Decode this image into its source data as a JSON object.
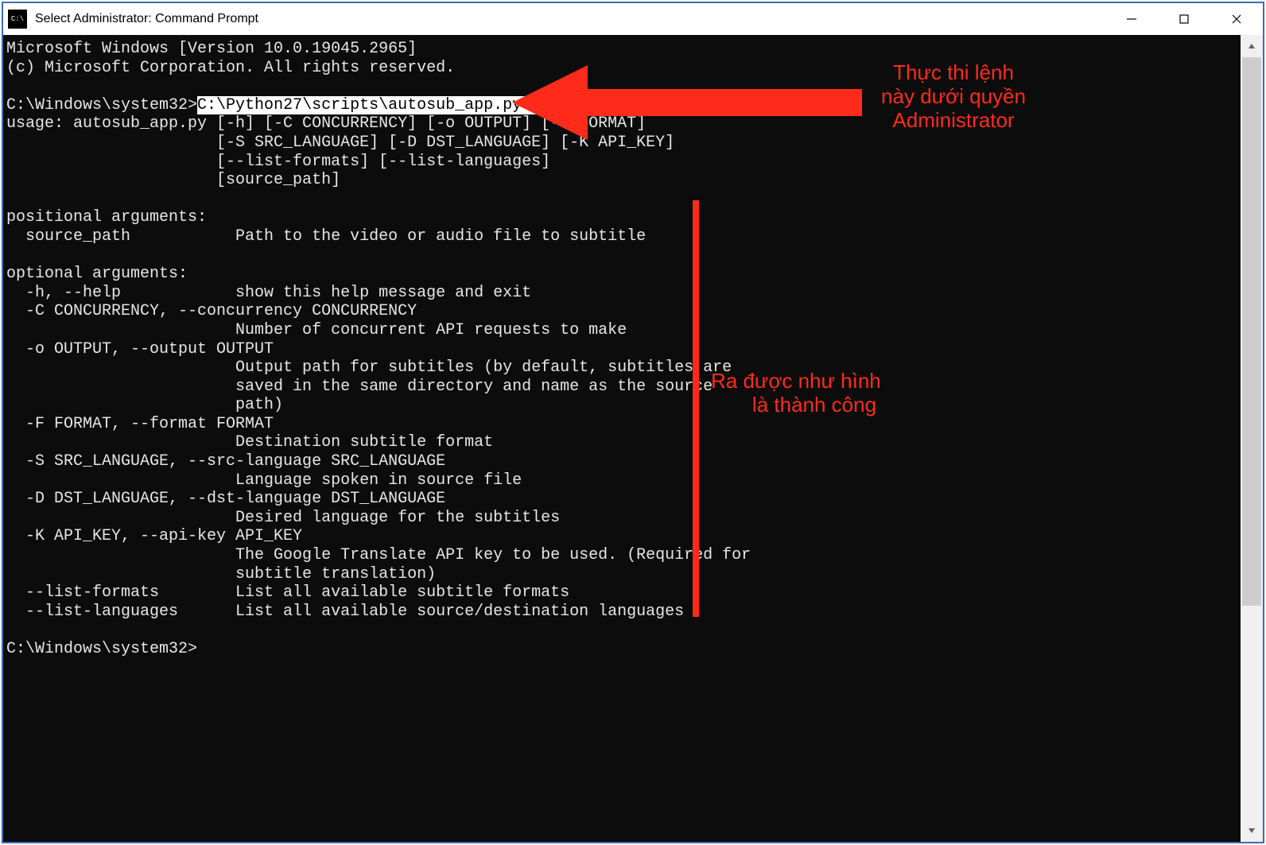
{
  "window": {
    "icon_label": "C:\\",
    "title": "Select Administrator: Command Prompt"
  },
  "terminal": {
    "line_os_version": "Microsoft Windows [Version 10.0.19045.2965]",
    "line_copyright": "(c) Microsoft Corporation. All rights reserved.",
    "prompt1_prefix": "C:\\Windows\\system32>",
    "prompt1_command": "C:\\Python27\\scripts\\autosub_app.py -h",
    "usage_1": "usage: autosub_app.py [-h] [-C CONCURRENCY] [-o OUTPUT] [-F FORMAT]",
    "usage_2": "                      [-S SRC_LANGUAGE] [-D DST_LANGUAGE] [-K API_KEY]",
    "usage_3": "                      [--list-formats] [--list-languages]",
    "usage_4": "                      [source_path]",
    "pos_header": "positional arguments:",
    "pos_source": "  source_path           Path to the video or audio file to subtitle",
    "opt_header": "optional arguments:",
    "opt_h": "  -h, --help            show this help message and exit",
    "opt_c1": "  -C CONCURRENCY, --concurrency CONCURRENCY",
    "opt_c2": "                        Number of concurrent API requests to make",
    "opt_o1": "  -o OUTPUT, --output OUTPUT",
    "opt_o2": "                        Output path for subtitles (by default, subtitles are",
    "opt_o3": "                        saved in the same directory and name as the source",
    "opt_o4": "                        path)",
    "opt_f1": "  -F FORMAT, --format FORMAT",
    "opt_f2": "                        Destination subtitle format",
    "opt_s1": "  -S SRC_LANGUAGE, --src-language SRC_LANGUAGE",
    "opt_s2": "                        Language spoken in source file",
    "opt_d1": "  -D DST_LANGUAGE, --dst-language DST_LANGUAGE",
    "opt_d2": "                        Desired language for the subtitles",
    "opt_k1": "  -K API_KEY, --api-key API_KEY",
    "opt_k2": "                        The Google Translate API key to be used. (Required for",
    "opt_k3": "                        subtitle translation)",
    "opt_lf": "  --list-formats        List all available subtitle formats",
    "opt_ll": "  --list-languages      List all available source/destination languages",
    "prompt2": "C:\\Windows\\system32>"
  },
  "annotations": {
    "top_line1": "Thực thi lệnh",
    "top_line2": "này dưới quyền",
    "top_line3": "Administrator",
    "bottom_line1": "Ra được như hình",
    "bottom_line2": "là thành công"
  },
  "colors": {
    "annotation": "#ff2b1a",
    "terminal_bg": "#0c0c0c",
    "terminal_fg": "#e6e6e6"
  }
}
